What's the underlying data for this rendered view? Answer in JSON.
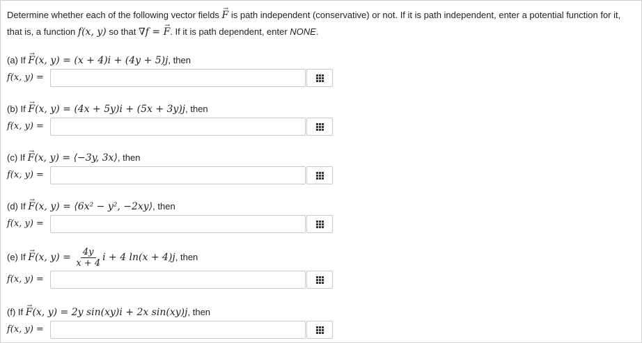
{
  "intro": {
    "line1_a": "Determine whether each of the following vector fields ",
    "line1_b": " is path independent (conservative) or not. If it is path independent, enter a potential function for it,",
    "line2_a": "that is, a function ",
    "line2_b": " so that ",
    "line2_c": ". If it is path dependent, enter ",
    "line2_none": "NONE",
    "line2_end": "."
  },
  "math": {
    "F": "F",
    "fxy": "f(x, y)",
    "grad": "∇f = ",
    "Fxy": "(x, y) = "
  },
  "parts": [
    {
      "prefix": "(a) If ",
      "field": "(x + 4)i + (4y + 5)j",
      "suffix": ", then",
      "answer_label": "f(x, y) =",
      "value": ""
    },
    {
      "prefix": "(b) If ",
      "field": "(4x + 5y)i + (5x + 3y)j",
      "suffix": ", then",
      "answer_label": "f(x, y) =",
      "value": ""
    },
    {
      "prefix": "(c) If ",
      "field": "⟨−3y, 3x⟩",
      "suffix": ", then",
      "answer_label": "f(x, y) =",
      "value": ""
    },
    {
      "prefix": "(d) If ",
      "field": "⟨6x² − y², −2xy⟩",
      "suffix": ", then",
      "answer_label": "f(x, y) =",
      "value": ""
    },
    {
      "prefix": "(e) If ",
      "frac_num": "4y",
      "frac_den": "x + 4",
      "field_rest": "i + 4 ln(x + 4)j",
      "suffix": ", then",
      "answer_label": "f(x, y) =",
      "value": ""
    },
    {
      "prefix": "(f) If ",
      "field": "2y sin(xy)i + 2x sin(xy)j",
      "suffix": ", then",
      "answer_label": "f(x, y) =",
      "value": ""
    }
  ],
  "icons": {
    "keypad": "keypad-grid-icon"
  },
  "colors": {
    "border": "#c9c9c9",
    "text": "#222222",
    "icon": "#333333"
  }
}
